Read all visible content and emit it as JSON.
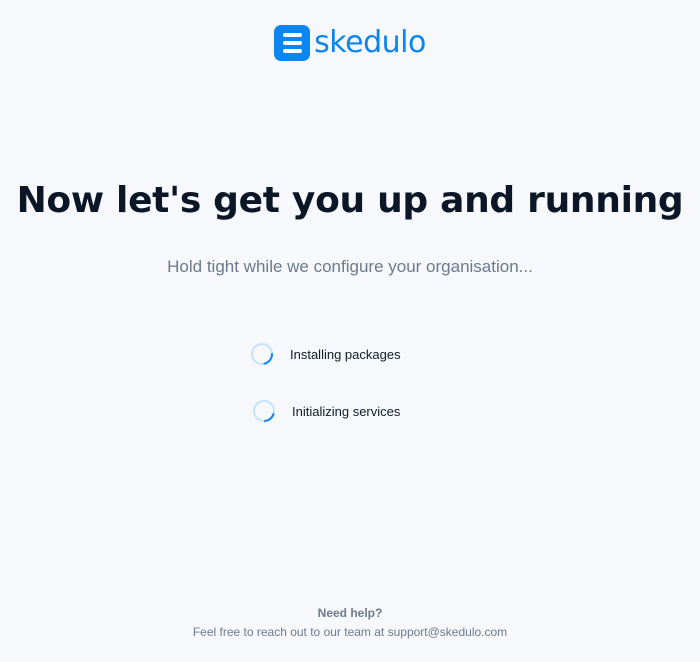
{
  "brand": {
    "name": "skedulo",
    "color": "#0b86f0"
  },
  "headline": "Now let's get you up and running",
  "subheadline": "Hold tight while we configure your organisation...",
  "steps": [
    {
      "label": "Installing packages",
      "status": "in-progress",
      "icon": "loading-spinner-icon"
    },
    {
      "label": "Initializing services",
      "status": "in-progress",
      "icon": "loading-spinner-icon"
    }
  ],
  "footer": {
    "title": "Need help?",
    "text": "Feel free to reach out to our team at support@skedulo.com"
  },
  "colors": {
    "background": "#f6f8fb",
    "headline": "#0b1726",
    "muted": "#6d7a8c",
    "spinner_track": "#c7e2f8",
    "spinner_arc": "#0b86f0"
  }
}
